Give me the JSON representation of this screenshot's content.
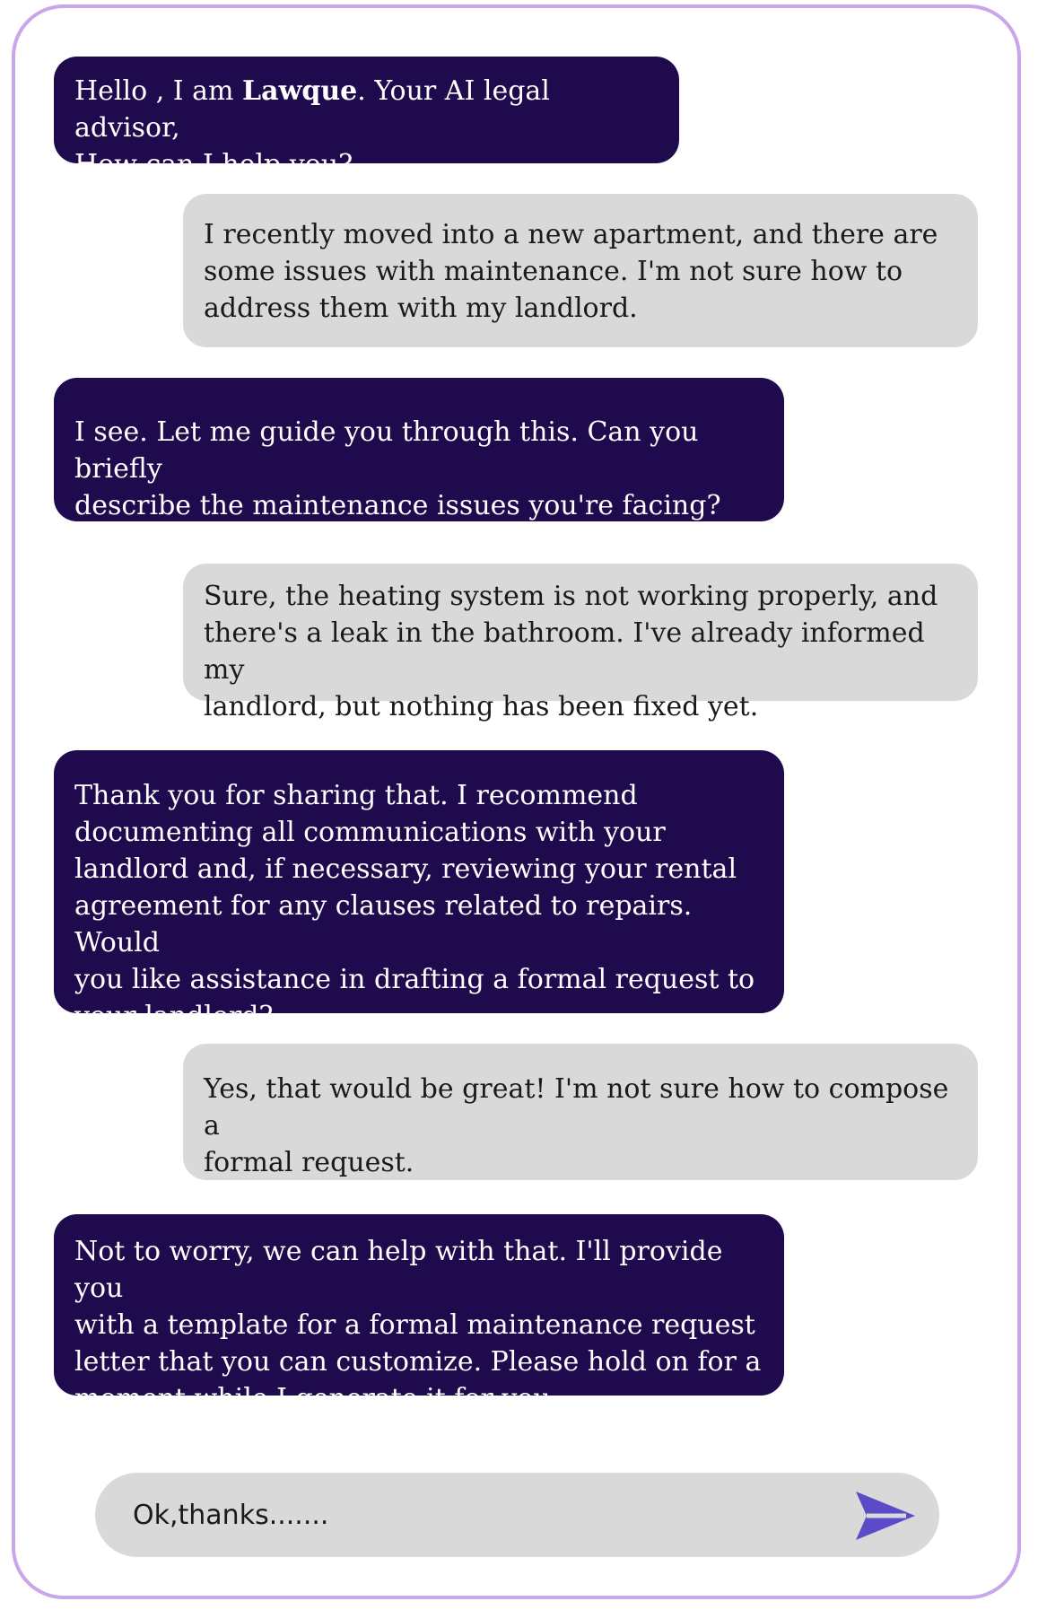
{
  "messages": [
    {
      "role": "bot",
      "prefix": "Hello , I am ",
      "name": "Lawque",
      "suffix": ". Your AI legal advisor,\nHow can I help you?"
    },
    {
      "role": "user",
      "text": "I recently moved into a new apartment, and there are\nsome issues with maintenance. I'm not sure how to\naddress them with my landlord."
    },
    {
      "role": "bot",
      "text": "I see. Let me guide you through this. Can you briefly\ndescribe the maintenance issues you're facing?"
    },
    {
      "role": "user",
      "text": "Sure, the heating system is not working properly, and\nthere's a leak in the bathroom. I've already informed my\nlandlord, but nothing has been fixed yet."
    },
    {
      "role": "bot",
      "text": "Thank you for sharing that. I recommend\ndocumenting all communications with your\nlandlord and, if necessary, reviewing your rental\nagreement for any clauses related to repairs. Would\nyou like assistance in drafting a formal request to\nyour landlord?"
    },
    {
      "role": "user",
      "text": "Yes, that would be great! I'm not sure how to compose a\nformal request."
    },
    {
      "role": "bot",
      "text": "Not to worry, we can help with that. I'll provide you\nwith a template for a formal maintenance request\nletter that you can customize. Please hold on for a\nmoment while I generate it for you."
    }
  ],
  "composer": {
    "value": "Ok,thanks.......",
    "send_icon": "send-arrow-icon"
  },
  "colors": {
    "frame_border": "#c9a6e8",
    "bot_bubble": "#1e0a4d",
    "user_bubble": "#d9d9d9",
    "send_icon": "#5b4bc8"
  }
}
